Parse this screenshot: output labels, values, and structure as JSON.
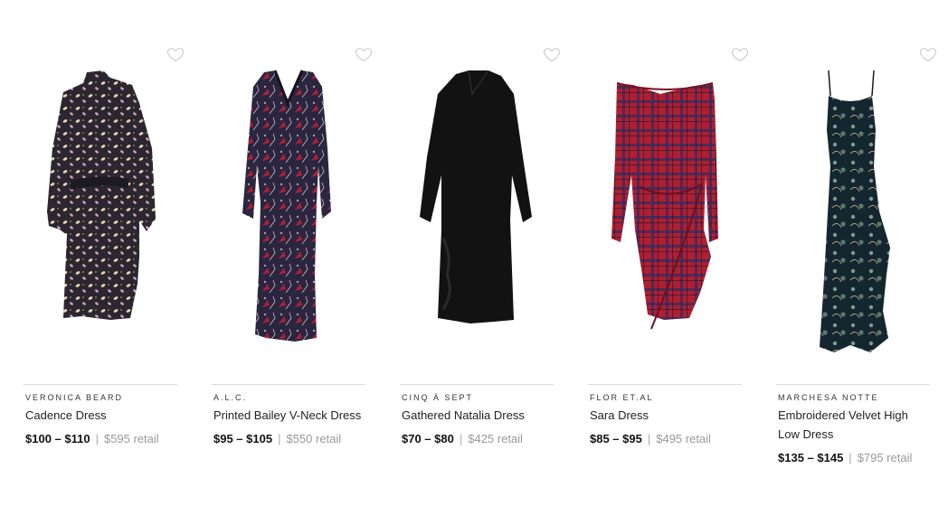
{
  "products": [
    {
      "brand": "VERONICA BEARD",
      "name": "Cadence Dress",
      "rent_price": "$100 – $110",
      "separator": "|",
      "retail_price": "$595 retail",
      "favorite_icon": "heart-outline-icon"
    },
    {
      "brand": "A.L.C.",
      "name": "Printed Bailey V-Neck Dress",
      "rent_price": "$95 – $105",
      "separator": "|",
      "retail_price": "$550 retail",
      "favorite_icon": "heart-outline-icon"
    },
    {
      "brand": "CINQ À SEPT",
      "name": "Gathered Natalia Dress",
      "rent_price": "$70 – $80",
      "separator": "|",
      "retail_price": "$425 retail",
      "favorite_icon": "heart-outline-icon"
    },
    {
      "brand": "FLOR ET.AL",
      "name": "Sara Dress",
      "rent_price": "$85 – $95",
      "separator": "|",
      "retail_price": "$495 retail",
      "favorite_icon": "heart-outline-icon"
    },
    {
      "brand": "MARCHESA NOTTE",
      "name": "Embroidered Velvet High Low Dress",
      "rent_price": "$135 – $145",
      "separator": "|",
      "retail_price": "$795 retail",
      "favorite_icon": "heart-outline-icon"
    }
  ],
  "colors": {
    "divider": "#dcdcdc",
    "heart": "#c8c8c8",
    "retail": "#999999"
  }
}
